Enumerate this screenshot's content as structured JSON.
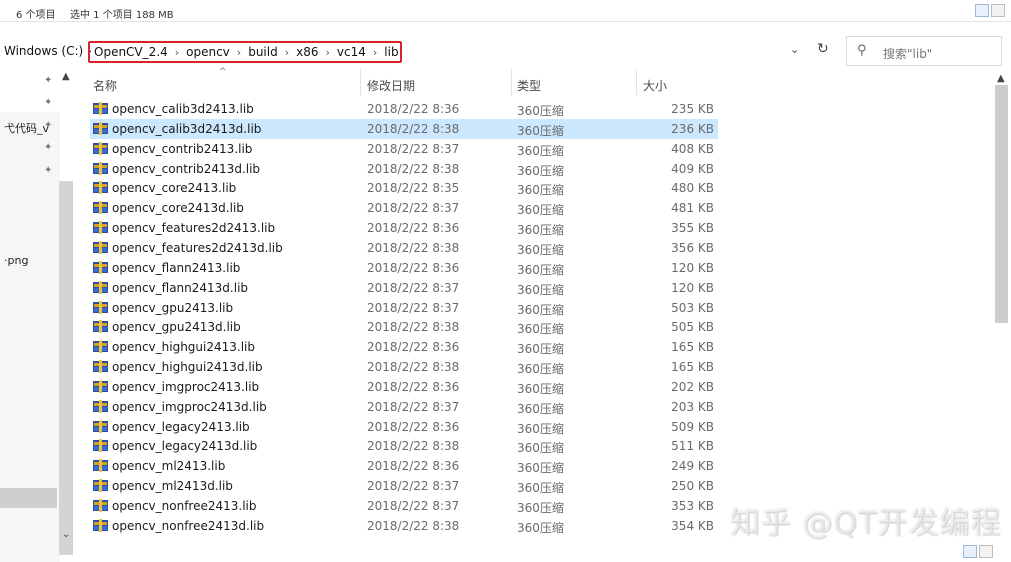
{
  "status_bar": {
    "item_count": "6 个项目",
    "selection": "选中 1 个项目  188 MB"
  },
  "address": {
    "prefix": "Windows (C:)",
    "crumbs": [
      "OpenCV_2.4",
      "opencv",
      "build",
      "x86",
      "vc14",
      "lib"
    ],
    "highlight_color": "#d8232a"
  },
  "search": {
    "placeholder": "搜索\"lib\""
  },
  "nav": {
    "labels": [
      "弋代码_v",
      "·png"
    ]
  },
  "columns": {
    "name": "名称",
    "date": "修改日期",
    "type": "类型",
    "size": "大小"
  },
  "files": [
    {
      "name": "opencv_calib3d2413.lib",
      "date": "2018/2/22 8:36",
      "type": "360压缩",
      "size": "235 KB"
    },
    {
      "name": "opencv_calib3d2413d.lib",
      "date": "2018/2/22 8:38",
      "type": "360压缩",
      "size": "236 KB",
      "selected": true
    },
    {
      "name": "opencv_contrib2413.lib",
      "date": "2018/2/22 8:37",
      "type": "360压缩",
      "size": "408 KB"
    },
    {
      "name": "opencv_contrib2413d.lib",
      "date": "2018/2/22 8:38",
      "type": "360压缩",
      "size": "409 KB"
    },
    {
      "name": "opencv_core2413.lib",
      "date": "2018/2/22 8:35",
      "type": "360压缩",
      "size": "480 KB"
    },
    {
      "name": "opencv_core2413d.lib",
      "date": "2018/2/22 8:37",
      "type": "360压缩",
      "size": "481 KB"
    },
    {
      "name": "opencv_features2d2413.lib",
      "date": "2018/2/22 8:36",
      "type": "360压缩",
      "size": "355 KB"
    },
    {
      "name": "opencv_features2d2413d.lib",
      "date": "2018/2/22 8:38",
      "type": "360压缩",
      "size": "356 KB"
    },
    {
      "name": "opencv_flann2413.lib",
      "date": "2018/2/22 8:36",
      "type": "360压缩",
      "size": "120 KB"
    },
    {
      "name": "opencv_flann2413d.lib",
      "date": "2018/2/22 8:37",
      "type": "360压缩",
      "size": "120 KB"
    },
    {
      "name": "opencv_gpu2413.lib",
      "date": "2018/2/22 8:37",
      "type": "360压缩",
      "size": "503 KB"
    },
    {
      "name": "opencv_gpu2413d.lib",
      "date": "2018/2/22 8:38",
      "type": "360压缩",
      "size": "505 KB"
    },
    {
      "name": "opencv_highgui2413.lib",
      "date": "2018/2/22 8:36",
      "type": "360压缩",
      "size": "165 KB"
    },
    {
      "name": "opencv_highgui2413d.lib",
      "date": "2018/2/22 8:38",
      "type": "360压缩",
      "size": "165 KB"
    },
    {
      "name": "opencv_imgproc2413.lib",
      "date": "2018/2/22 8:36",
      "type": "360压缩",
      "size": "202 KB"
    },
    {
      "name": "opencv_imgproc2413d.lib",
      "date": "2018/2/22 8:37",
      "type": "360压缩",
      "size": "203 KB"
    },
    {
      "name": "opencv_legacy2413.lib",
      "date": "2018/2/22 8:36",
      "type": "360压缩",
      "size": "509 KB"
    },
    {
      "name": "opencv_legacy2413d.lib",
      "date": "2018/2/22 8:38",
      "type": "360压缩",
      "size": "511 KB"
    },
    {
      "name": "opencv_ml2413.lib",
      "date": "2018/2/22 8:36",
      "type": "360压缩",
      "size": "249 KB"
    },
    {
      "name": "opencv_ml2413d.lib",
      "date": "2018/2/22 8:37",
      "type": "360压缩",
      "size": "250 KB"
    },
    {
      "name": "opencv_nonfree2413.lib",
      "date": "2018/2/22 8:37",
      "type": "360压缩",
      "size": "353 KB"
    },
    {
      "name": "opencv_nonfree2413d.lib",
      "date": "2018/2/22 8:38",
      "type": "360压缩",
      "size": "354 KB"
    }
  ],
  "icons": {
    "file": "winrar-archive-icon",
    "pin": "pin-icon",
    "search": "search-icon",
    "refresh": "refresh-icon",
    "dropdown": "chevron-down-icon"
  },
  "colors": {
    "selected_row": "#cce8ff",
    "archive_blue": "#2c4fa3",
    "archive_gold": "#d9a21b"
  },
  "watermark": {
    "text": "知乎 @QT开发编程"
  }
}
